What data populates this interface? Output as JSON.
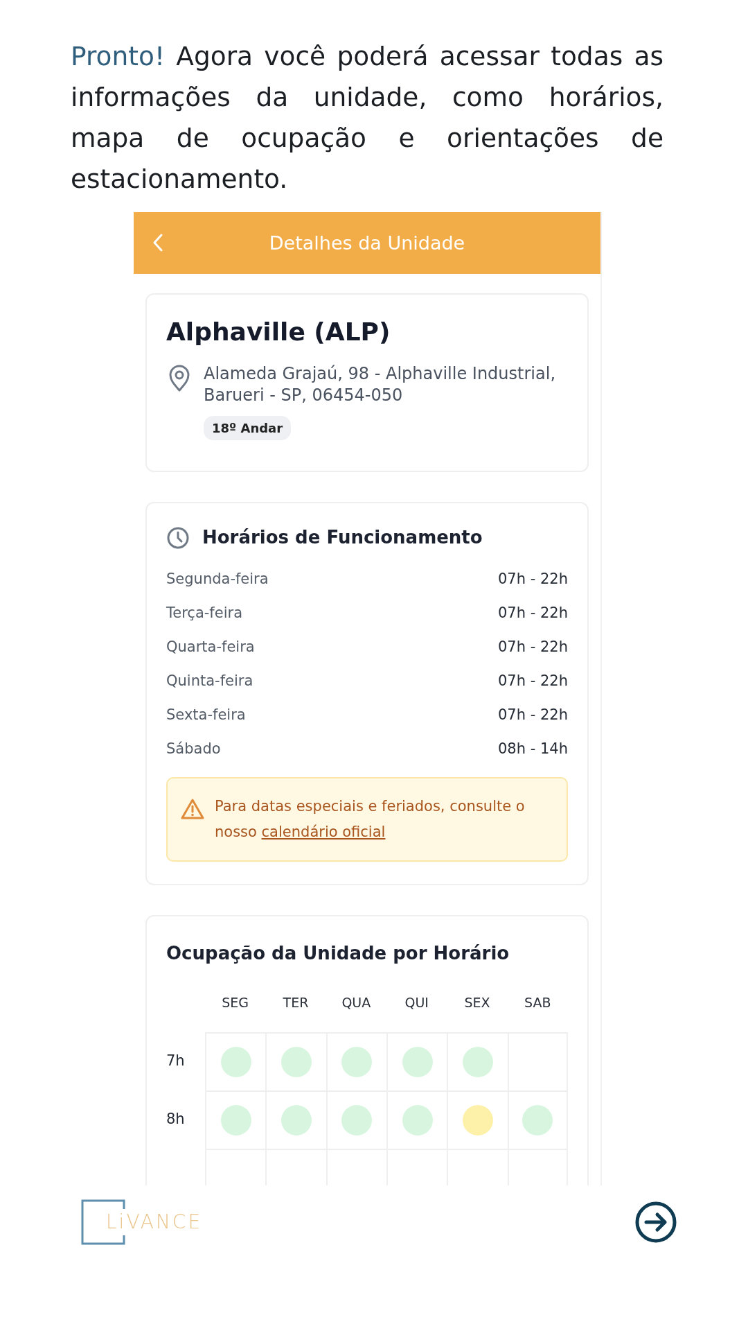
{
  "intro": {
    "highlight": "Pronto!",
    "text": "Agora você poderá acessar todas as informações da unidade, como horários, mapa de ocupação e orientações de estacionamento."
  },
  "screen": {
    "header": {
      "title": "Detalhes da Unidade"
    },
    "unit": {
      "name": "Alphaville (ALP)",
      "address": "Alameda Grajaú, 98 - Alphaville Industrial, Barueri - SP, 06454-050",
      "floor": "18º Andar"
    },
    "hours": {
      "title": "Horários de Funcionamento",
      "rows": [
        {
          "day": "Segunda-feira",
          "time": "07h - 22h"
        },
        {
          "day": "Terça-feira",
          "time": "07h - 22h"
        },
        {
          "day": "Quarta-feira",
          "time": "07h - 22h"
        },
        {
          "day": "Quinta-feira",
          "time": "07h - 22h"
        },
        {
          "day": "Sexta-feira",
          "time": "07h - 22h"
        },
        {
          "day": "Sábado",
          "time": "08h - 14h"
        }
      ],
      "notice": {
        "text": "Para datas especiais e feriados, consulte o nosso",
        "link": "calendário oficial"
      }
    },
    "occupancy": {
      "title": "Ocupação da Unidade por Horário",
      "columns": [
        "SEG",
        "TER",
        "QUA",
        "QUI",
        "SEX",
        "SAB"
      ],
      "rows": [
        {
          "hour": "7h",
          "cells": [
            {
              "kind": "dot",
              "color": "#d8f6df"
            },
            {
              "kind": "dot",
              "color": "#d8f6df"
            },
            {
              "kind": "dot",
              "color": "#d8f6df"
            },
            {
              "kind": "dot",
              "color": "#d8f6df"
            },
            {
              "kind": "dot",
              "color": "#d8f6df"
            },
            {
              "kind": "empty"
            }
          ]
        },
        {
          "hour": "8h",
          "cells": [
            {
              "kind": "dot",
              "color": "#d8f6df"
            },
            {
              "kind": "dot",
              "color": "#d8f6df"
            },
            {
              "kind": "dot",
              "color": "#d8f6df"
            },
            {
              "kind": "dot",
              "color": "#d8f6df"
            },
            {
              "kind": "dot",
              "color": "#fdf1a9"
            },
            {
              "kind": "dot",
              "color": "#d8f6df"
            }
          ]
        }
      ]
    }
  },
  "footer": {
    "logo": "LiVANCE"
  }
}
